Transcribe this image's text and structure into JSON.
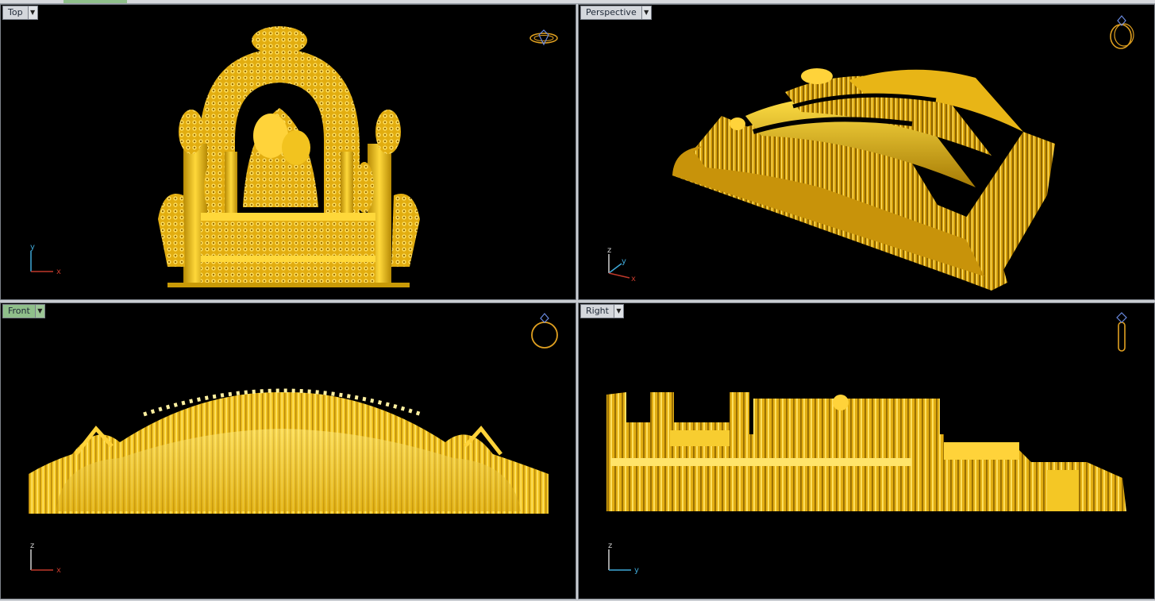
{
  "viewports": {
    "top": {
      "title": "Top",
      "axes": {
        "vertical": "y",
        "horizontal": "x"
      },
      "active": false
    },
    "perspective": {
      "title": "Perspective",
      "axes": {
        "vertical": "z",
        "diagonal": "y",
        "horizontal": "x"
      },
      "active": false
    },
    "front": {
      "title": "Front",
      "axes": {
        "vertical": "z",
        "horizontal": "x"
      },
      "active": true
    },
    "right": {
      "title": "Right",
      "axes": {
        "vertical": "z",
        "horizontal": "y"
      },
      "active": false
    }
  },
  "colors": {
    "viewport_bg": "#000000",
    "model_gold": "#e6b512",
    "model_highlight": "#ffe56a",
    "model_shadow": "#8a6400",
    "active_title": "#8fbf8a",
    "axis_x": "#c0392b",
    "axis_y": "#3fa9d8",
    "axis_z": "#d0d0d0"
  },
  "icons": {
    "viewport_menu": "chevron-down-icon",
    "view_orientation": "ring-icon",
    "axis_gizmo": "axis-icon"
  }
}
